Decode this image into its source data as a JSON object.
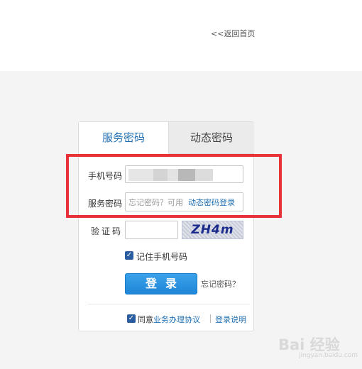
{
  "header": {
    "back_link": "<<返回首页"
  },
  "tabs": [
    {
      "label": "服务密码",
      "active": true
    },
    {
      "label": "动态密码",
      "active": false
    }
  ],
  "form": {
    "phone_label": "手机号码",
    "phone_value_obscured": true,
    "password_label": "服务密码",
    "password_placeholder_prefix": "忘记密码？可用",
    "password_placeholder_link": "动态密码登录",
    "captcha_label": "验证码",
    "captcha_text": "ZH4m",
    "remember_label": "记住手机号码",
    "remember_checked": true,
    "login_button": "登录",
    "forgot_password": "忘记密码？"
  },
  "footer": {
    "agree_prefix": "同意",
    "agreement_link": "业务办理协议",
    "agree_checked": true,
    "login_help": "登录说明"
  },
  "watermark": {
    "text": "Bai 经验",
    "sub": "jingyan.baidu.com"
  },
  "colors": {
    "accent_blue": "#1f6fb2",
    "button_blue": "#1f86d8",
    "highlight_red": "#e8323a",
    "background_gray": "#f4f4f4"
  }
}
